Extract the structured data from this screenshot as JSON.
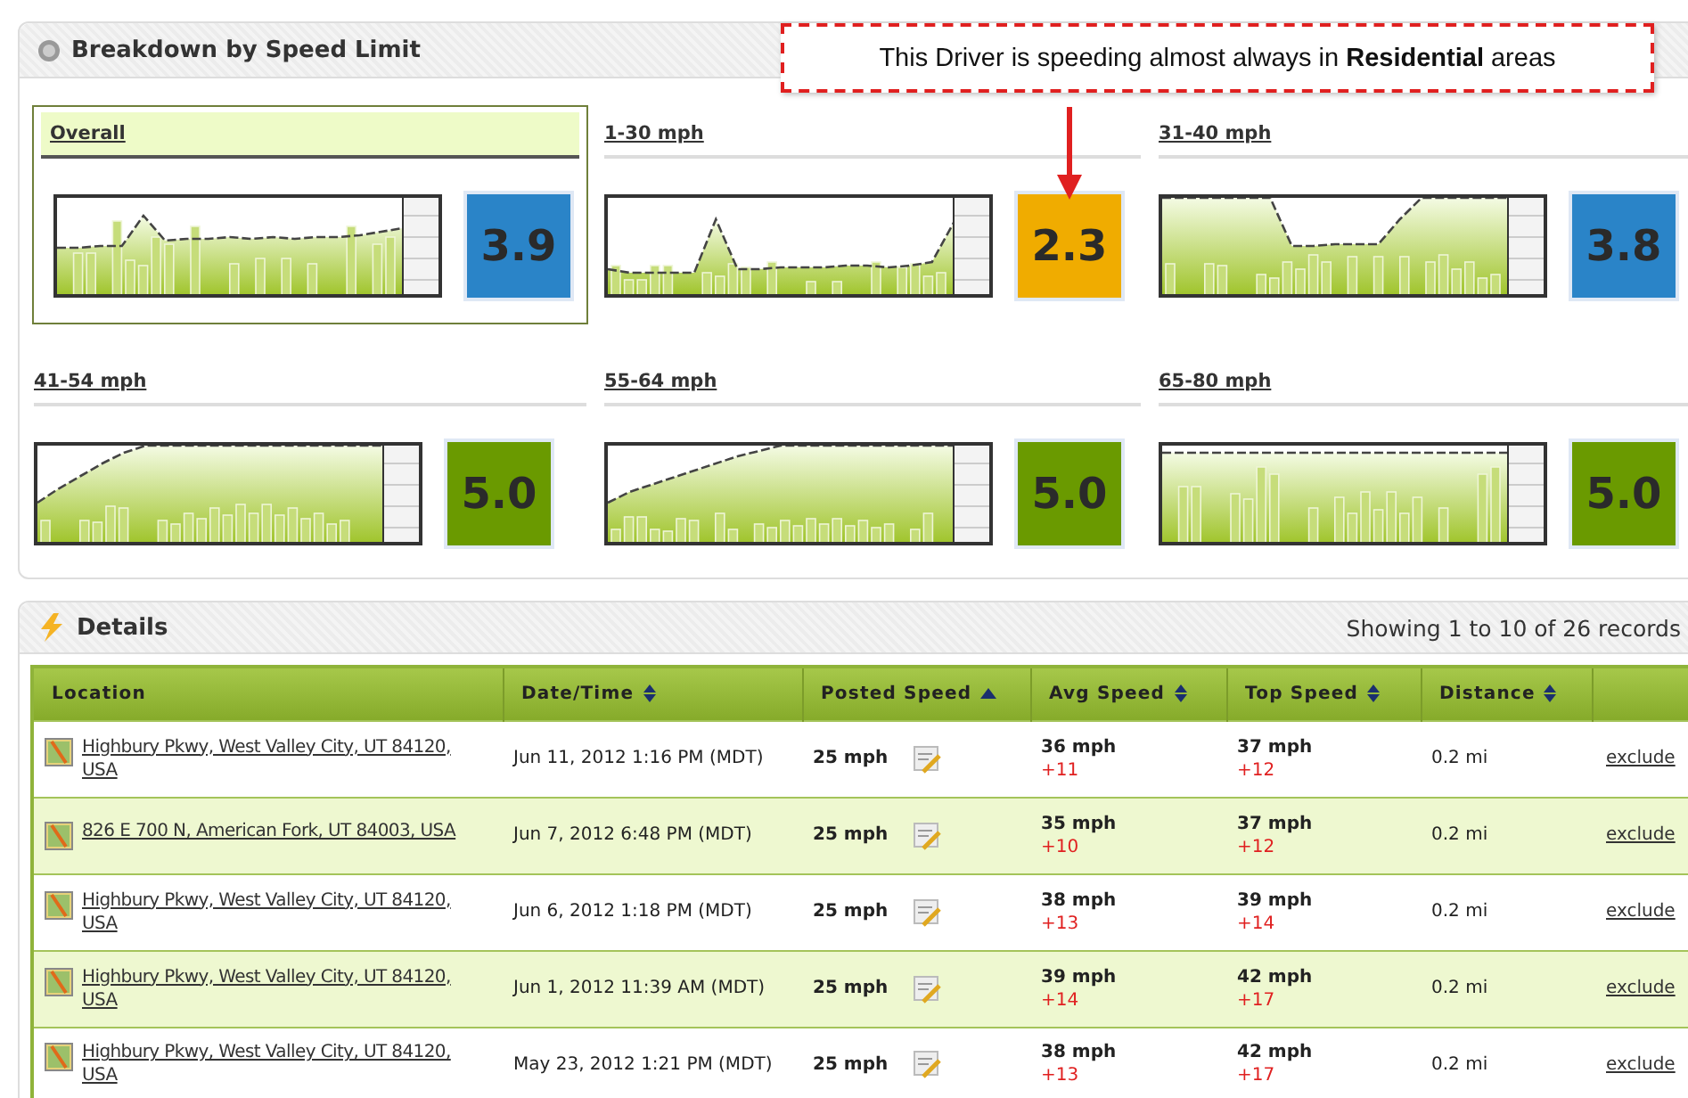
{
  "breakdown": {
    "title": "Breakdown by Speed Limit",
    "callout": "This Driver is speeding almost always in **Residential** areas",
    "cards": [
      {
        "label": "Overall",
        "selected": true,
        "score": "3.9",
        "color": "#2a84c8"
      },
      {
        "label": "1-30 mph",
        "selected": false,
        "score": "2.3",
        "color": "#f0ac00"
      },
      {
        "label": "31-40 mph",
        "selected": false,
        "score": "3.8",
        "color": "#2a84c8"
      },
      {
        "label": "41-54 mph",
        "selected": false,
        "score": "5.0",
        "color": "#6a9a00"
      },
      {
        "label": "55-64 mph",
        "selected": false,
        "score": "5.0",
        "color": "#6a9a00"
      },
      {
        "label": "65-80 mph",
        "selected": false,
        "score": "5.0",
        "color": "#6a9a00"
      }
    ]
  },
  "details": {
    "title": "Details",
    "summary": "Showing 1 to 10 of 26 records",
    "columns": [
      {
        "label": "Location",
        "sortable": false
      },
      {
        "label": "Date/Time",
        "sortable": true,
        "sorted_ascending": false
      },
      {
        "label": "Posted Speed",
        "sortable": true,
        "sorted_ascending": true
      },
      {
        "label": "Avg Speed",
        "sortable": true,
        "sorted_ascending": false
      },
      {
        "label": "Top Speed",
        "sortable": true,
        "sorted_ascending": false
      },
      {
        "label": "Distance",
        "sortable": true,
        "sorted_ascending": false
      }
    ],
    "rows": [
      {
        "location": "Highbury Pkwy, West Valley City, UT 84120, USA",
        "datetime": "Jun 11, 2012 1:16 PM (MDT)",
        "posted": "25 mph",
        "avg": "36 mph",
        "avg_over": "+11",
        "top": "37 mph",
        "top_over": "+12",
        "distance": "0.2 mi",
        "action": "exclude"
      },
      {
        "location": "826 E 700 N, American Fork, UT 84003, USA",
        "datetime": "Jun 7, 2012 6:48 PM (MDT)",
        "posted": "25 mph",
        "avg": "35 mph",
        "avg_over": "+10",
        "top": "37 mph",
        "top_over": "+12",
        "distance": "0.2 mi",
        "action": "exclude"
      },
      {
        "location": "Highbury Pkwy, West Valley City, UT 84120, USA",
        "datetime": "Jun 6, 2012 1:18 PM (MDT)",
        "posted": "25 mph",
        "avg": "38 mph",
        "avg_over": "+13",
        "top": "39 mph",
        "top_over": "+14",
        "distance": "0.2 mi",
        "action": "exclude"
      },
      {
        "location": "Highbury Pkwy, West Valley City, UT 84120, USA",
        "datetime": "Jun 1, 2012 11:39 AM (MDT)",
        "posted": "25 mph",
        "avg": "39 mph",
        "avg_over": "+14",
        "top": "42 mph",
        "top_over": "+17",
        "distance": "0.2 mi",
        "action": "exclude"
      },
      {
        "location": "Highbury Pkwy, West Valley City, UT 84120, USA",
        "datetime": "May 23, 2012 1:21 PM (MDT)",
        "posted": "25 mph",
        "avg": "38 mph",
        "avg_over": "+13",
        "top": "42 mph",
        "top_over": "+17",
        "distance": "0.2 mi",
        "action": "exclude"
      }
    ]
  }
}
